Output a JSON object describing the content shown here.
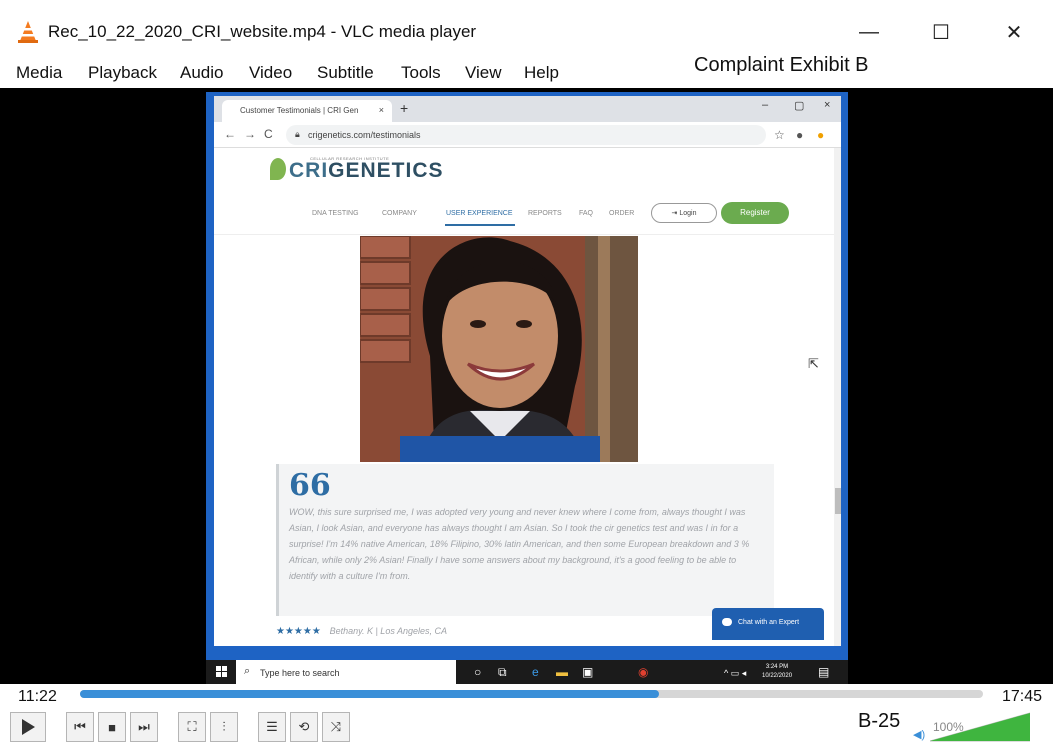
{
  "window": {
    "title": "Rec_10_22_2020_CRI_website.mp4 - VLC media player",
    "minimize": "—",
    "maximize": "☐",
    "close": "✕"
  },
  "menu": [
    "Media",
    "Playback",
    "Audio",
    "Video",
    "Subtitle",
    "Tools",
    "View",
    "Help"
  ],
  "exhibit_label": "Complaint Exhibit B",
  "browser": {
    "tab_title": "Customer Testimonials | CRI Gen",
    "tab_close": "×",
    "new_tab": "+",
    "url": "crigenetics.com/testimonials",
    "win_min": "–",
    "win_max": "▢",
    "win_close": "×"
  },
  "site": {
    "logo_sub": "CELLULAR RESEARCH INSTITUTE",
    "logo_cri": "CRI",
    "logo_genetics": "GENETICS",
    "nav": [
      "DNA TESTING",
      "COMPANY",
      "USER EXPERIENCE",
      "REPORTS",
      "FAQ",
      "ORDER"
    ],
    "nav_active": "USER EXPERIENCE",
    "login": "Login",
    "register": "Register",
    "quote_mark": "66",
    "testimonial": "WOW, this sure surprised me, I was adopted very young and never knew where I come from, always thought I was Asian, I look Asian, and everyone has always thought I am Asian. So I took the cir genetics test and was I in for a surprise! I'm 14% native American, 18% Filipino, 30% latin American, and then some European breakdown and 3 % African, while only 2% Asian! Finally I have some answers about my background, it's a good feeling to be able to identify with a culture I'm from.",
    "stars": "★★★★★",
    "reviewer": "Bethany. K | Los Angeles, CA",
    "chat": "Chat with an Expert"
  },
  "taskbar": {
    "search_placeholder": "Type here to search",
    "time": "3:24 PM",
    "date": "10/22/2020"
  },
  "player": {
    "elapsed": "11:22",
    "total": "17:45",
    "progress": 0.641,
    "volume_label": "100%",
    "exhibit_page": "B-25"
  },
  "colors": {
    "vlc_orange": "#f47b20",
    "seek_blue": "#3a8fd8",
    "cri_green": "#6bab4f",
    "cri_blue": "#2e6da4",
    "desktop_blue": "#1e63c4"
  }
}
